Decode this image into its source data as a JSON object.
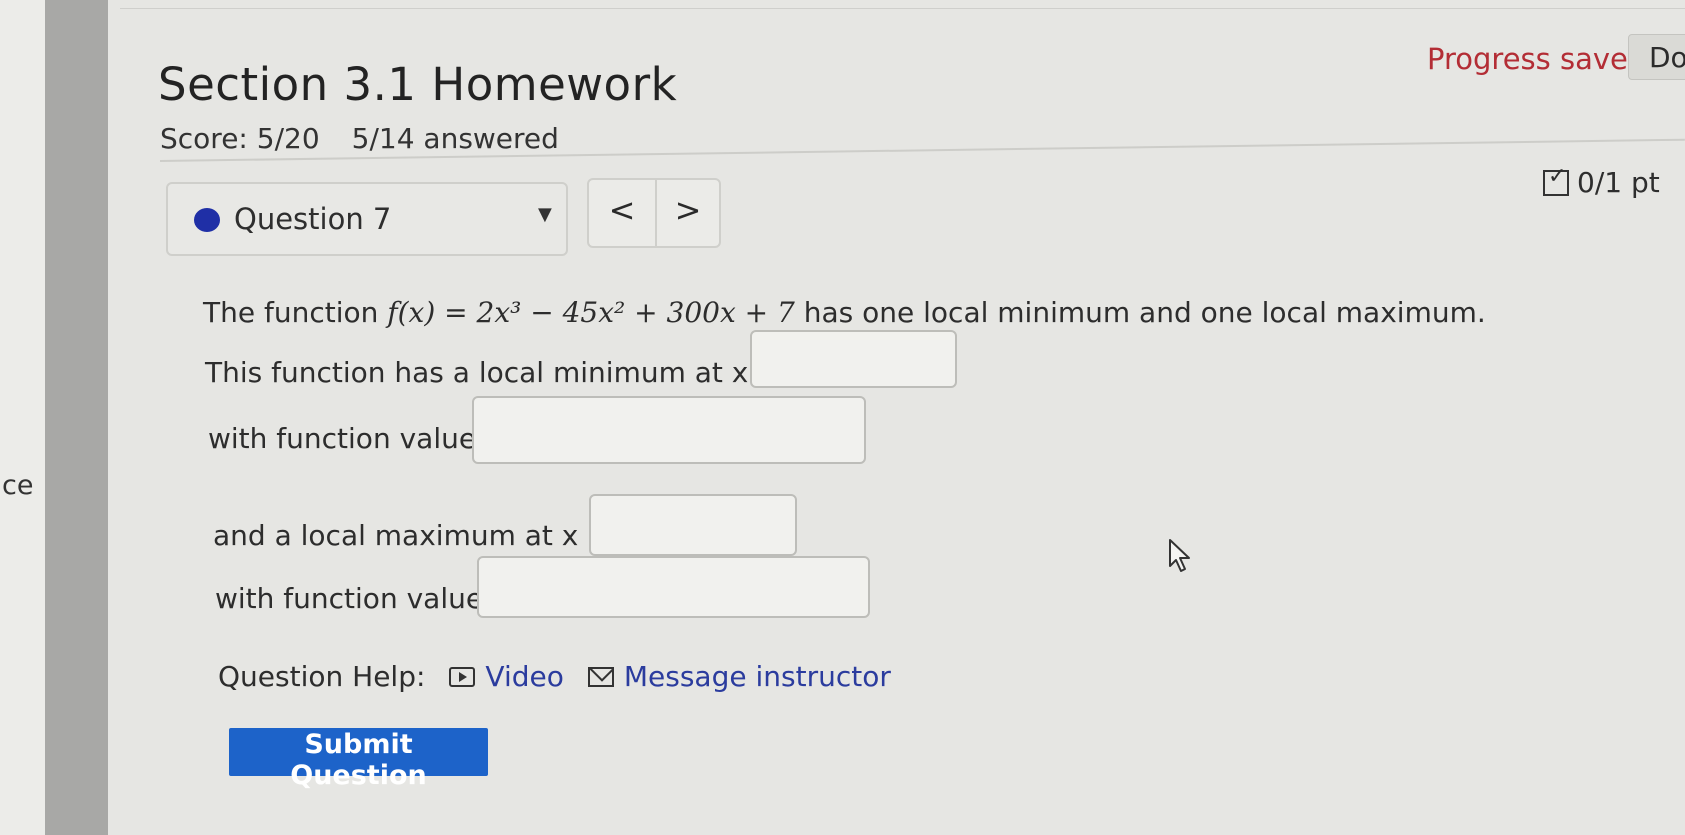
{
  "sidebar": {
    "partial_text": "ce"
  },
  "header": {
    "title": "Section 3.1 Homework",
    "score": "Score: 5/20",
    "answered": "5/14 answered",
    "progress_status": "Progress saved",
    "partial_button": "Do"
  },
  "question_nav": {
    "current": "Question 7",
    "prev_glyph": "<",
    "next_glyph": ">",
    "points": "0/1 pt"
  },
  "question": {
    "intro_before": "The function ",
    "equation": "f(x) = 2x³ − 45x² + 300x + 7",
    "intro_after": " has one local minimum and one local maximum.",
    "min_x_label": "This function has a local minimum at x =",
    "min_value_label": "with function value",
    "max_x_label": "and a local maximum at x =",
    "max_value_label": "with function value"
  },
  "answers": {
    "min_x": "",
    "min_value": "",
    "max_x": "",
    "max_value": ""
  },
  "help": {
    "label": "Question Help:",
    "video": "Video",
    "message": "Message instructor"
  },
  "submit_label": "Submit Question",
  "colors": {
    "accent_blue": "#1d63c9",
    "link": "#2b3c9e",
    "progress_red": "#b32d35",
    "question_dot": "#1f2fa6"
  }
}
